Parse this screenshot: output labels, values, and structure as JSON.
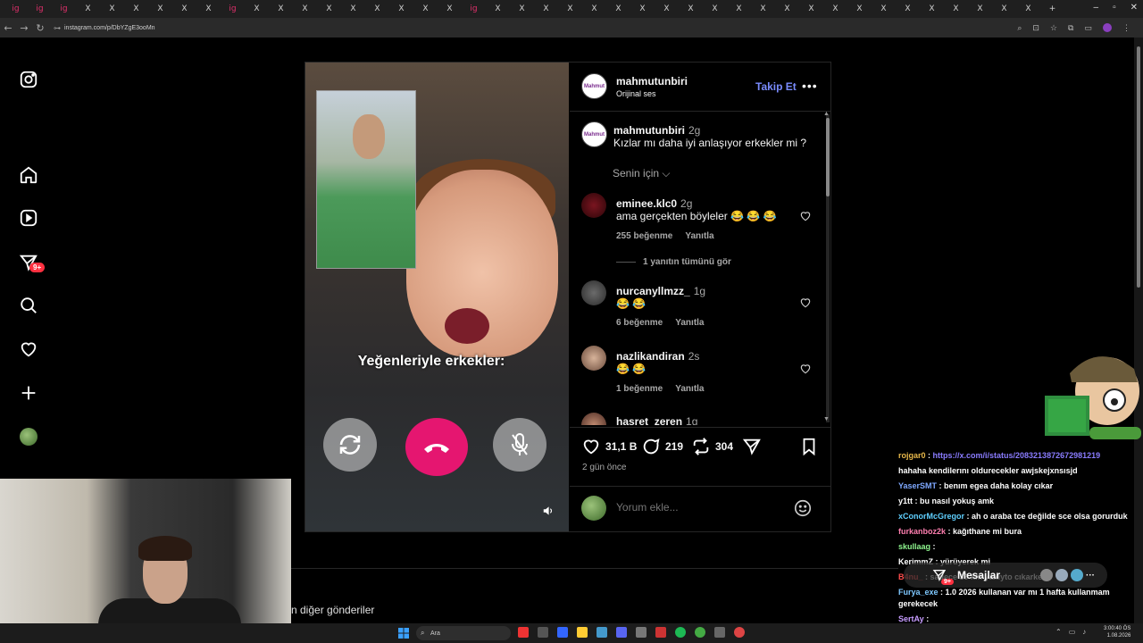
{
  "browser": {
    "tabs": [
      "ig",
      "ig",
      "ig",
      "X",
      "X",
      "X",
      "X",
      "X",
      "X",
      "ig",
      "X",
      "X",
      "X",
      "X",
      "X",
      "X",
      "X",
      "X",
      "X",
      "ig",
      "X",
      "X",
      "X",
      "X",
      "X",
      "X",
      "X",
      "X",
      "X",
      "X",
      "X",
      "X",
      "X",
      "X",
      "X",
      "X",
      "X",
      "X",
      "X",
      "X",
      "X",
      "X",
      "X"
    ],
    "new_tab": "+",
    "url": "instagram.com/p/DbYZgE3ooMn",
    "window_controls": [
      "–",
      "▫",
      "✕"
    ]
  },
  "sidebar": {
    "notification_badge": "9+"
  },
  "post": {
    "video_caption": "Yeğenleriyle erkekler:",
    "author": "mahmutunbiri",
    "author_avatar_text": "Mahmut",
    "audio": "Orijinal ses",
    "follow": "Takip Et",
    "more": "•••",
    "caption": {
      "user": "mahmutunbiri",
      "time": "2g",
      "text": "Kızlar mı daha iyi anlaşıyor erkekler mi ?"
    },
    "sort": "Senin için ⌵",
    "comments": [
      {
        "user": "eminee.klc0",
        "time": "2g",
        "text": "ama gerçekten böyleler 😂 😂 😂",
        "likes": "255 beğenme",
        "reply": "Yanıtla"
      },
      {
        "user": "nurcanyllmzz_",
        "time": "1g",
        "text": "😂 😂",
        "likes": "6 beğenme",
        "reply": "Yanıtla"
      },
      {
        "user": "nazlikandiran",
        "time": "2s",
        "text": "😂 😂",
        "likes": "1 beğenme",
        "reply": "Yanıtla"
      },
      {
        "user": "hasret_zeren",
        "time": "1g",
        "text": "",
        "likes": "",
        "reply": ""
      }
    ],
    "view_replies": "1 yanıtın tümünü gör",
    "likes": "31,1 B",
    "comments_count": "219",
    "reposts": "304",
    "date": "2 gün önce",
    "comment_placeholder": "Yorum ekle...",
    "more_posts": "n diğer gönderiler"
  },
  "chat": [
    {
      "user": "rojgar0",
      "color": "#e8b84a",
      "text": "https://x.com/i/status/2083213872672981219",
      "text_color": "#8a7cff"
    },
    {
      "user": "",
      "color": "#ffffff",
      "text": "hahaha kendilerını oldurecekler awjskejxnsısjd",
      "text_color": "#ffffff"
    },
    {
      "user": "YaserSMT",
      "color": "#7ea8ff",
      "text": "benım egea daha kolay cıkar",
      "text_color": "#ffffff"
    },
    {
      "user": "y1tt",
      "color": "#ffffff",
      "text": "bu nasıl yokuş amk",
      "text_color": "#ffffff"
    },
    {
      "user": "xConorMcGregor",
      "color": "#5fd0ff",
      "text": "ah o araba tce değilde sce olsa gorurduk",
      "text_color": "#ffffff"
    },
    {
      "user": "furkanboz2k",
      "color": "#ff7fb0",
      "text": "kağıthane mi bura",
      "text_color": "#ffffff"
    },
    {
      "user": "skullaag",
      "color": "#8ef58e",
      "text": "",
      "text_color": "#ffffff"
    },
    {
      "user": "KerimmZ",
      "color": "#ffffff",
      "text": "yürüyerek mi",
      "text_color": "#ffffff"
    },
    {
      "user": "B4nu_",
      "color": "#ff4d4d",
      "text": "sadece 39 km yakıyto cıkarken",
      "text_color": "#ffffff"
    },
    {
      "user": "Furya_exe",
      "color": "#7ec8ff",
      "text": "1.0 2026 kullanan var mı 1 hafta kullanmam gerekecek",
      "text_color": "#ffffff"
    },
    {
      "user": "SertAy",
      "color": "#c79cff",
      "text": "",
      "text_color": "#ffffff"
    }
  ],
  "messages_pill": {
    "label": "Mesajlar",
    "badge": "9+"
  },
  "taskbar": {
    "search": "Ara",
    "clock_time": "3:00:40 ÖS",
    "clock_date": "1.08.2026"
  }
}
